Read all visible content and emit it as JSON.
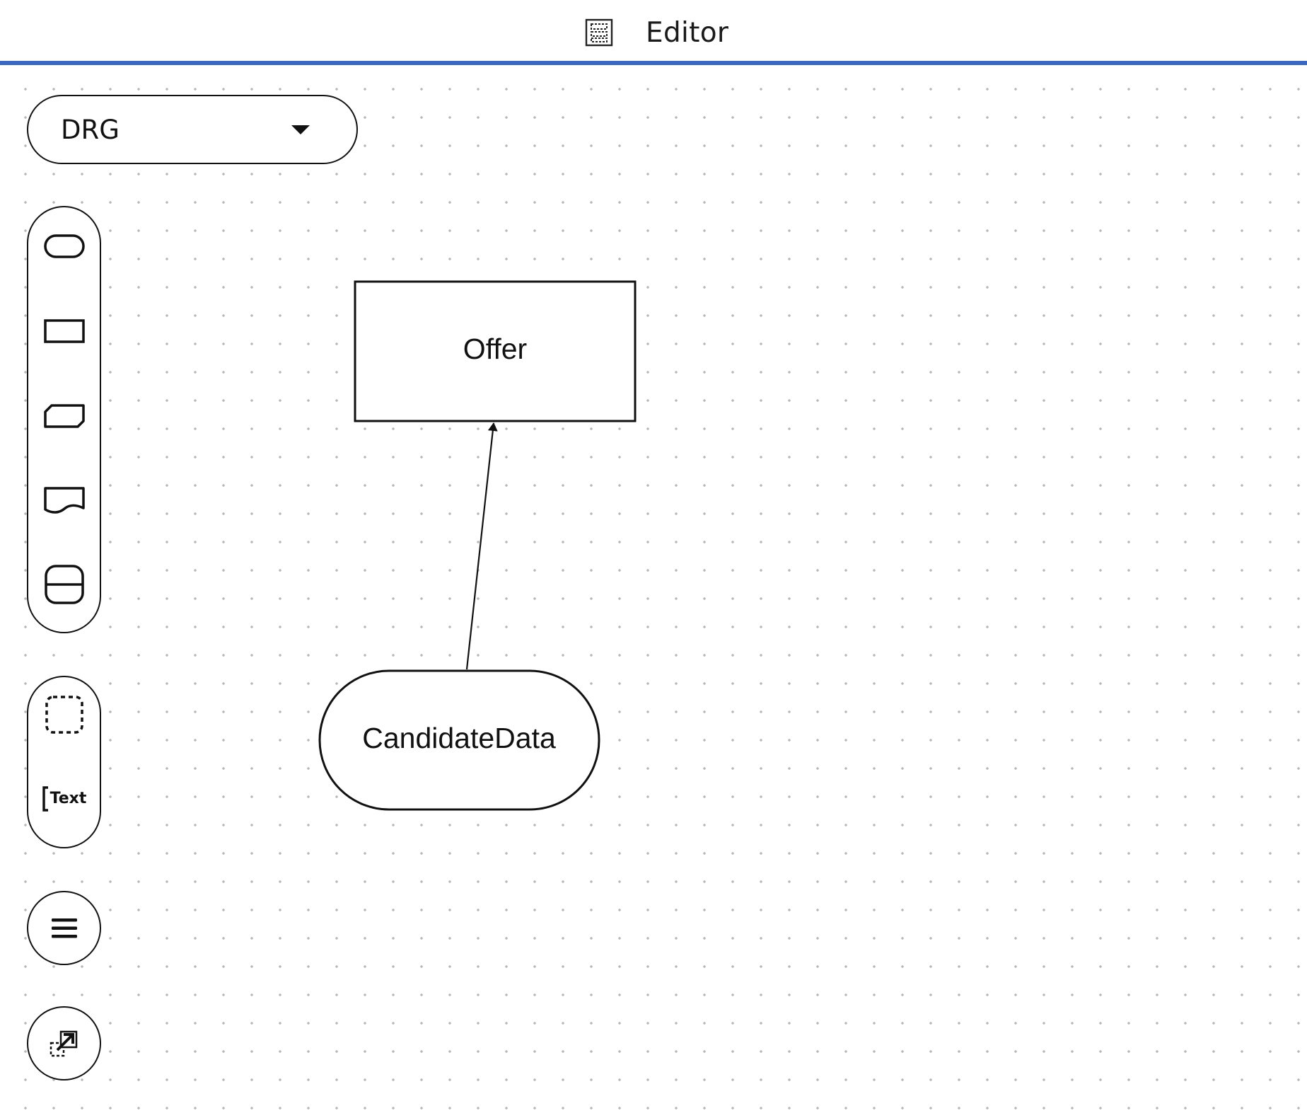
{
  "app": {
    "title": "Editor",
    "title_icon": "editor-table-icon",
    "accent_color": "#3a66c4"
  },
  "view_selector": {
    "value": "DRG",
    "caret_icon": "caret-down-icon"
  },
  "palette": {
    "shape_tools": [
      {
        "name": "input-data",
        "icon": "rounded-pill-icon"
      },
      {
        "name": "decision",
        "icon": "rectangle-icon"
      },
      {
        "name": "business-knowledge-model",
        "icon": "cut-corner-rectangle-icon"
      },
      {
        "name": "knowledge-source",
        "icon": "wavy-document-icon"
      },
      {
        "name": "decision-service",
        "icon": "split-rounded-rectangle-icon"
      }
    ],
    "misc_tools": [
      {
        "name": "group",
        "icon": "dashed-square-icon"
      },
      {
        "name": "text-annotation",
        "icon": "text-annotation-icon",
        "label": "Text"
      }
    ],
    "menu_icon": "hamburger-menu-icon",
    "export_icon": "export-arrow-icon"
  },
  "diagram": {
    "nodes": [
      {
        "id": "offer",
        "type": "decision",
        "label": "Offer"
      },
      {
        "id": "candidate-data",
        "type": "input-data",
        "label": "CandidateData"
      }
    ],
    "edges": [
      {
        "from": "candidate-data",
        "to": "offer",
        "type": "information-requirement"
      }
    ]
  }
}
